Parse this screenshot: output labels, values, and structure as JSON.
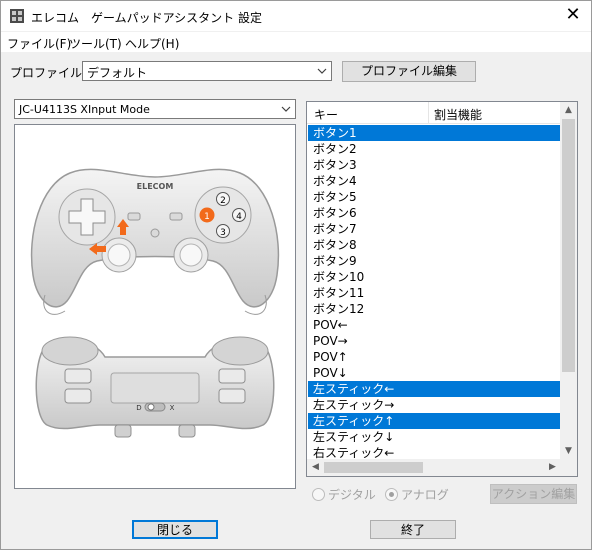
{
  "window": {
    "title": "エレコム　ゲームパッドアシスタント 設定"
  },
  "menu": {
    "items": [
      "ファイル(F)",
      "ツール(T)",
      "ヘルプ(H)"
    ]
  },
  "profile": {
    "label": "プロファイル:",
    "selected": "デフォルト",
    "edit_button": "プロファイル編集"
  },
  "device": {
    "selected": "JC-U4113S XInput Mode"
  },
  "gamepad_image": {
    "brand_text": "ELECOM",
    "button_numbers": [
      "1",
      "2",
      "3",
      "4"
    ],
    "switch_labels": [
      "D",
      "X"
    ],
    "accent_color": "#f26a1b"
  },
  "list": {
    "columns": [
      "キー",
      "割当機能"
    ],
    "rows": [
      "ボタン1",
      "ボタン2",
      "ボタン3",
      "ボタン4",
      "ボタン5",
      "ボタン6",
      "ボタン7",
      "ボタン8",
      "ボタン9",
      "ボタン10",
      "ボタン11",
      "ボタン12",
      "POV←",
      "POV→",
      "POV↑",
      "POV↓",
      "左スティック←",
      "左スティック→",
      "左スティック↑",
      "左スティック↓",
      "右スティック←"
    ],
    "selected_rows": [
      0,
      16,
      18
    ],
    "selection_color": "#0078d7"
  },
  "mode": {
    "digital_label": "デジタル",
    "analog_label": "アナログ",
    "selected": "アナログ"
  },
  "action_edit_button": "アクション編集",
  "footer": {
    "close_button": "閉じる",
    "exit_button": "終了"
  }
}
